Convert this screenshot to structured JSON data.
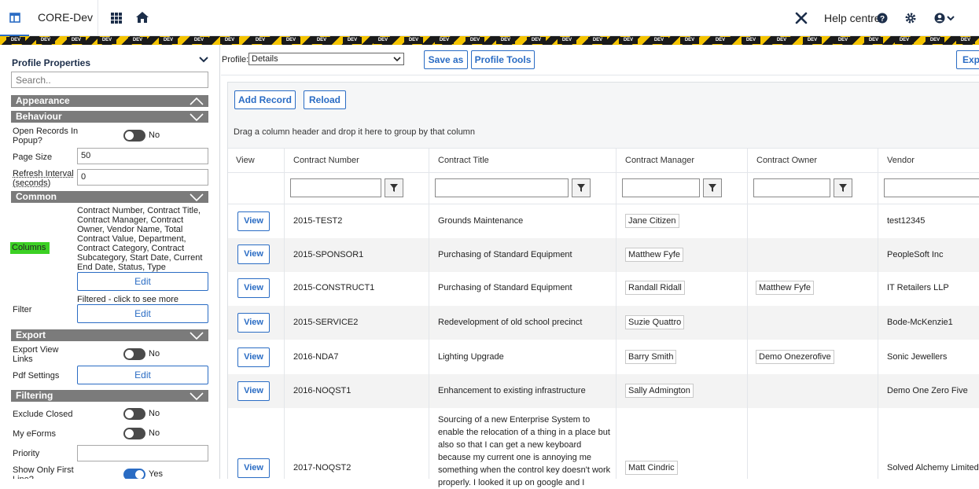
{
  "topbar": {
    "title": "CORE-Dev",
    "help_label": "Help centre"
  },
  "dev_tag": "DEV",
  "left_panel": {
    "title": "Profile Properties",
    "search_placeholder": "Search..",
    "sections": {
      "appearance": "Appearance",
      "behaviour": "Behaviour",
      "common": "Common",
      "export": "Export",
      "filtering": "Filtering"
    },
    "behaviour": {
      "open_popup_label": "Open Records In Popup?",
      "open_popup_value": "No",
      "page_size_label": "Page Size",
      "page_size_value": "50",
      "refresh_label": "Refresh Interval (seconds)",
      "refresh_value": "0"
    },
    "common": {
      "columns_label": "Columns",
      "columns_value": "Contract Number, Contract Title, Contract Manager, Contract Owner, Vendor Name, Total Contract Value, Department, Contract Category, Contract Subcategory, Start Date, Current End Date, Status, Type",
      "columns_edit": "Edit",
      "filter_label": "Filter",
      "filter_note": "Filtered - click to see more",
      "filter_edit": "Edit"
    },
    "export": {
      "export_links_label": "Export View Links",
      "export_links_value": "No",
      "pdf_label": "Pdf Settings",
      "pdf_edit": "Edit"
    },
    "filtering": {
      "exclude_closed_label": "Exclude Closed",
      "exclude_closed_value": "No",
      "my_eforms_label": "My eForms",
      "my_eforms_value": "No",
      "priority_label": "Priority",
      "priority_value": "",
      "show_only_first_label": "Show Only First Line?",
      "show_only_first_value": "Yes"
    }
  },
  "profile_bar": {
    "profile_label": "Profile:",
    "profile_value": "Details",
    "save_as": "Save as",
    "profile_tools": "Profile Tools",
    "export_partial": "Exp"
  },
  "grid": {
    "add_record": "Add Record",
    "reload": "Reload",
    "group_hint": "Drag a column header and drop it here to group by that column",
    "columns": [
      "View",
      "Contract Number",
      "Contract Title",
      "Contract Manager",
      "Contract Owner",
      "Vendor"
    ],
    "view_label": "View",
    "rows": [
      {
        "number": "2015-TEST2",
        "title": "Grounds Maintenance",
        "manager": "Jane Citizen",
        "owner": "",
        "vendor": "test12345"
      },
      {
        "number": "2015-SPONSOR1",
        "title": "Purchasing of Standard Equipment",
        "manager": "Matthew Fyfe",
        "owner": "",
        "vendor": "PeopleSoft Inc"
      },
      {
        "number": "2015-CONSTRUCT1",
        "title": "Purchasing of Standard Equipment",
        "manager": "Randall Ridall",
        "owner": "Matthew Fyfe",
        "vendor": "IT Retailers LLP"
      },
      {
        "number": "2015-SERVICE2",
        "title": "Redevelopment of old school precinct",
        "manager": "Suzie Quattro",
        "owner": "",
        "vendor": "Bode-McKenzie1"
      },
      {
        "number": "2016-NDA7",
        "title": "Lighting Upgrade",
        "manager": "Barry Smith",
        "owner": "Demo Onezerofive",
        "vendor": "Sonic Jewellers"
      },
      {
        "number": "2016-NOQST1",
        "title": "Enhancement to existing infrastructure",
        "manager": "Sally Admington",
        "owner": "",
        "vendor": "Demo One Zero Five"
      },
      {
        "number": "2017-NOQST2",
        "title": "Sourcing of a new Enterprise System to enable the relocation of a thing in a place but also so that I can get a new keyboard because my current one is annoying me something when the control key doesn't work properly. I looked it up on google and I",
        "manager": "Matt Cindric",
        "owner": "",
        "vendor": "Solved Alchemy Limited"
      }
    ]
  }
}
